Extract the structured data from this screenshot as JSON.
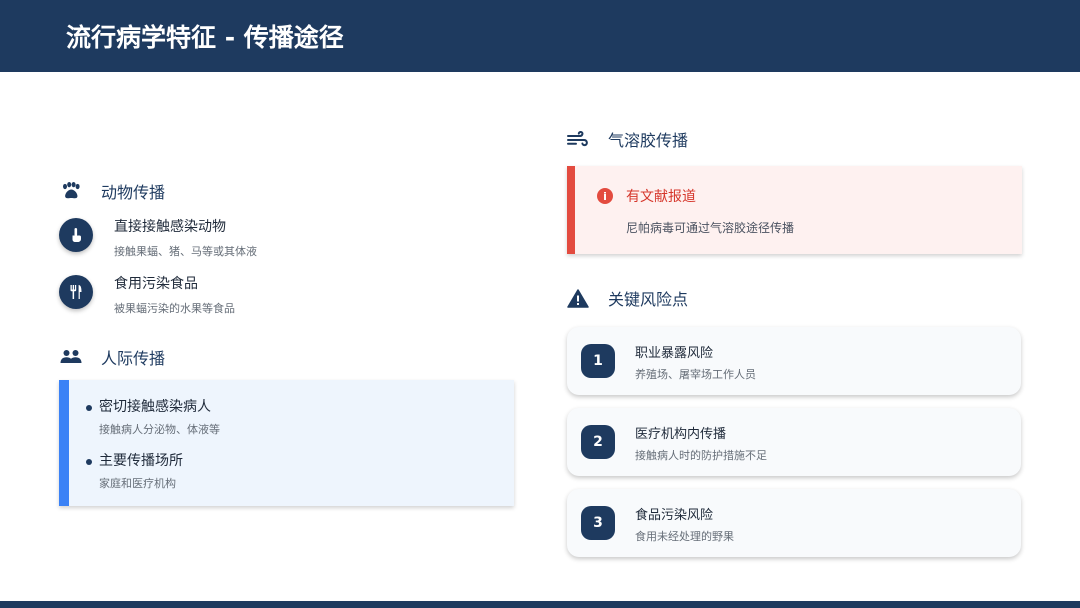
{
  "header": {
    "title": "流行病学特征 - 传播途径"
  },
  "animal": {
    "heading": "动物传播",
    "heading_icon": "paw-icon",
    "items": [
      {
        "icon": "hand-pointer-icon",
        "title": "直接接触感染动物",
        "desc": "接触果蝠、猪、马等或其体液"
      },
      {
        "icon": "utensils-icon",
        "title": "食用污染食品",
        "desc": "被果蝠污染的水果等食品"
      }
    ]
  },
  "human": {
    "heading": "人际传播",
    "heading_icon": "users-icon",
    "accent": "#3b82f6",
    "items": [
      {
        "title": "密切接触感染病人",
        "desc": "接触病人分泌物、体液等"
      },
      {
        "title": "主要传播场所",
        "desc": "家庭和医疗机构"
      }
    ]
  },
  "aerosol": {
    "heading": "气溶胶传播",
    "heading_icon": "wind-icon",
    "alert_icon": "exclamation-circle-icon",
    "alert_glyph": "i",
    "title": "有文献报道",
    "desc": "尼帕病毒可通过气溶胶途径传播",
    "accent": "#e34b3f"
  },
  "risks": {
    "heading": "关键风险点",
    "heading_icon": "warning-triangle-icon",
    "items": [
      {
        "num": "1",
        "title": "职业暴露风险",
        "desc": "养殖场、屠宰场工作人员"
      },
      {
        "num": "2",
        "title": "医疗机构内传播",
        "desc": "接触病人时的防护措施不足"
      },
      {
        "num": "3",
        "title": "食品污染风险",
        "desc": "食用未经处理的野果"
      }
    ]
  },
  "colors": {
    "primary": "#1e3a5f",
    "background": "#ffffff"
  }
}
